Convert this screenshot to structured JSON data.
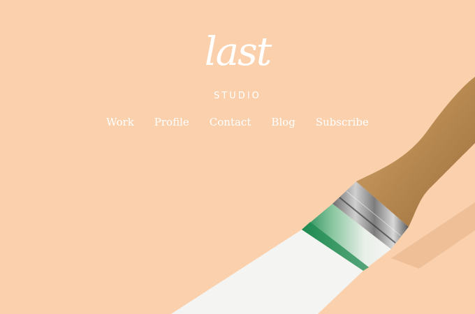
{
  "brand": {
    "script": "last",
    "sub": "STUDIO"
  },
  "nav": {
    "items": [
      {
        "label": "Work"
      },
      {
        "label": "Profile"
      },
      {
        "label": "Contact"
      },
      {
        "label": "Blog"
      },
      {
        "label": "Subscribe"
      }
    ]
  },
  "colors": {
    "background": "#fbd0ac",
    "text": "#ffffff",
    "paint_accent": "#1f8a52"
  },
  "hero": {
    "image": "paintbrush-icon"
  }
}
